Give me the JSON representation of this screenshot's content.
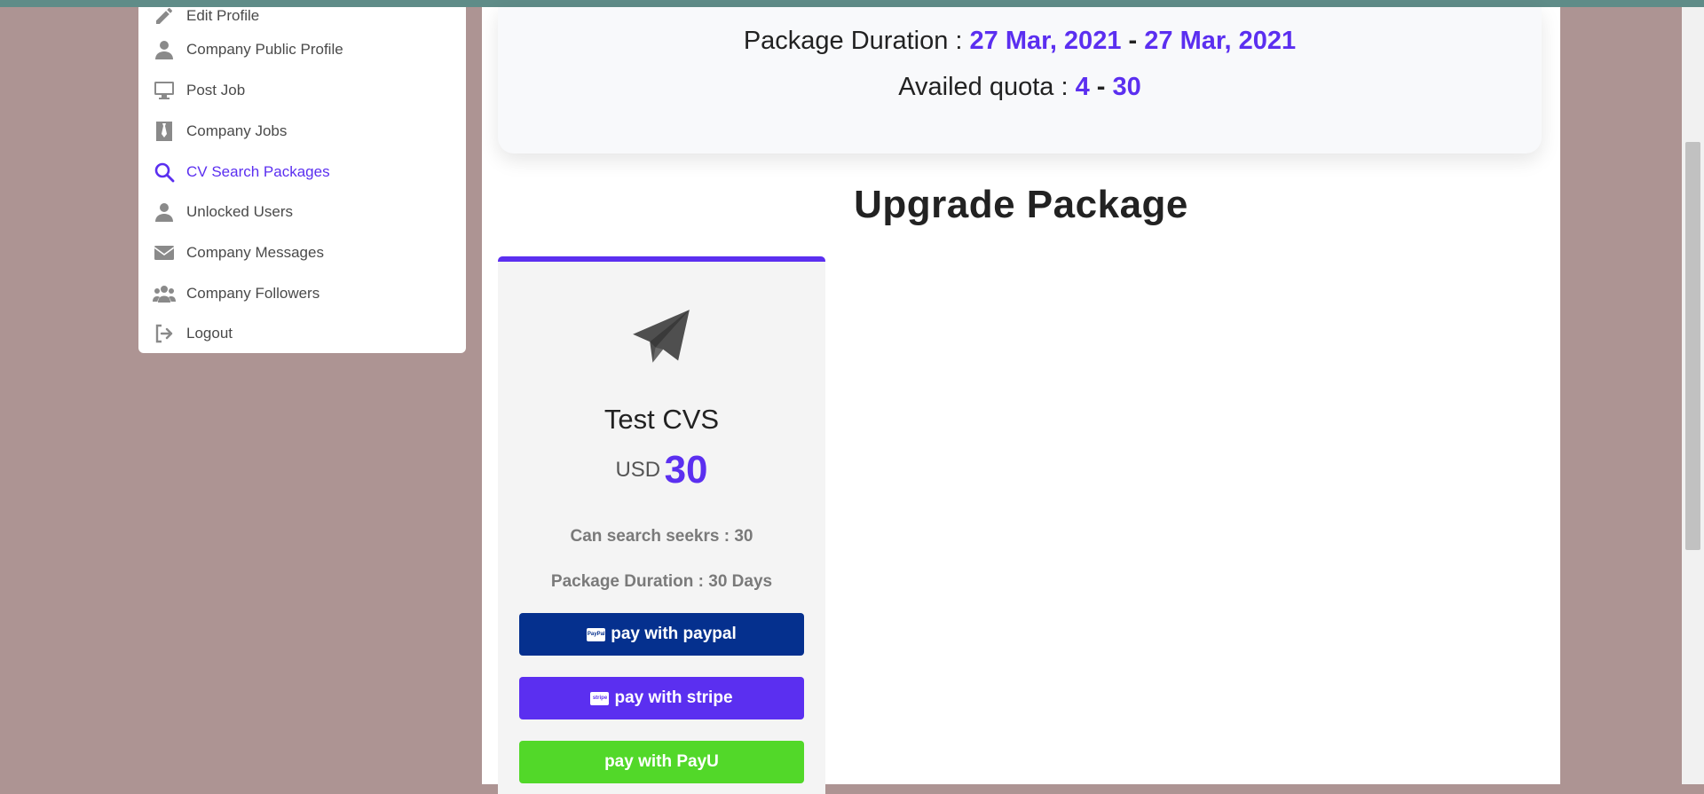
{
  "sidebar": {
    "items": [
      {
        "label": "Edit Profile",
        "icon": "pencil-icon"
      },
      {
        "label": "Company Public Profile",
        "icon": "user-icon"
      },
      {
        "label": "Post Job",
        "icon": "monitor-icon"
      },
      {
        "label": "Company Jobs",
        "icon": "briefcase-icon"
      },
      {
        "label": "CV Search Packages",
        "icon": "search-icon",
        "active": true
      },
      {
        "label": "Unlocked Users",
        "icon": "user-icon"
      },
      {
        "label": "Company Messages",
        "icon": "envelope-icon"
      },
      {
        "label": "Company Followers",
        "icon": "users-icon"
      },
      {
        "label": "Logout",
        "icon": "sign-out-icon"
      }
    ]
  },
  "current_package": {
    "duration_label": "Package Duration :",
    "start_date": "27 Mar, 2021",
    "separator": "-",
    "end_date": "27 Mar, 2021",
    "quota_label": "Availed quota :",
    "quota_used": "4",
    "quota_total": "30"
  },
  "upgrade": {
    "title": "Upgrade Package",
    "package": {
      "icon": "paper-plane-icon",
      "name": "Test CVS",
      "currency": "USD",
      "price": "30",
      "features": [
        "Can search seekrs : 30",
        "Package Duration : 30 Days"
      ],
      "buttons": {
        "paypal": "pay with paypal",
        "paypal_logo": "PayPal",
        "stripe": "pay with stripe",
        "stripe_logo": "stripe",
        "payu": "pay with PayU"
      }
    }
  },
  "colors": {
    "accent": "#5b2ff0",
    "paypal": "#05308e",
    "payu": "#52d829",
    "background": "#ad9493"
  }
}
